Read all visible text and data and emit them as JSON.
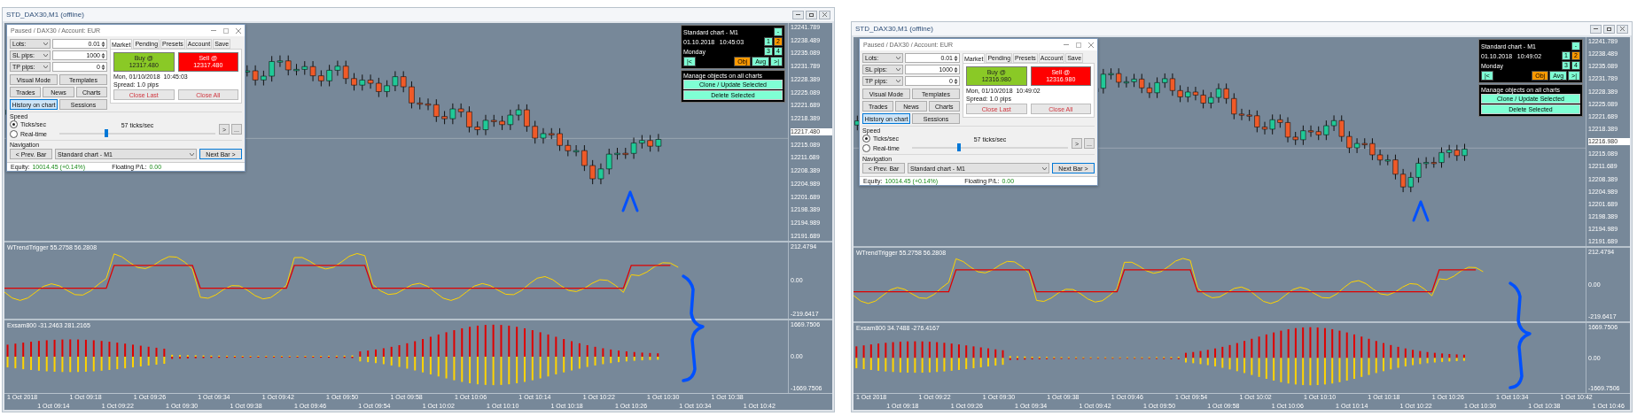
{
  "windows": [
    {
      "title": "STD_DAX30,M1 (offline)",
      "dialog": {
        "title": "Paused / DAX30 / Account: EUR",
        "params": [
          {
            "label": "Lots:",
            "value": "0.01"
          },
          {
            "label": "SL pips:",
            "value": "1000"
          },
          {
            "label": "TP pips:",
            "value": "0"
          }
        ],
        "buttons": [
          {
            "label": "Visual Mode",
            "selected": false
          },
          {
            "label": "Templates",
            "selected": false
          },
          {
            "label": "Trades",
            "selected": false
          },
          {
            "label": "News",
            "selected": false
          },
          {
            "label": "Charts",
            "selected": false
          },
          {
            "label": "History on chart",
            "selected": true
          },
          {
            "label": "Sessions",
            "selected": false
          }
        ],
        "tabs": [
          {
            "label": "Market",
            "selected": true
          },
          {
            "label": "Pending",
            "selected": false
          },
          {
            "label": "Presets",
            "selected": false
          },
          {
            "label": "Account",
            "selected": false
          },
          {
            "label": "Save",
            "selected": false
          }
        ],
        "buy": {
          "label": "Buy @",
          "price": "12317.480"
        },
        "sell": {
          "label": "Sell @",
          "price": "12317.480"
        },
        "time": "Mon, 01/10/2018  10:45:03",
        "spread": "Spread: 1.0 pips",
        "close_buttons": [
          "Close Last",
          "Close All"
        ],
        "speed": {
          "title": "Speed",
          "modes": [
            {
              "label": "Ticks/sec",
              "selected": true
            },
            {
              "label": "Real-time",
              "selected": false
            }
          ],
          "rate": "57 ticks/sec",
          "level": 0.3,
          "buttons": [
            ">",
            "..."
          ]
        },
        "navigation": {
          "title": "Navigation",
          "prev": "< Prev. Bar",
          "chart": "Standard chart - M1",
          "next": "Next Bar >"
        },
        "equity": {
          "label": "Equity:",
          "value": "10014.45 (+0.14%)"
        },
        "floating": {
          "label": "Floating P/L:",
          "value": "0.00"
        }
      },
      "overlay": {
        "chart": "Standard chart - M1",
        "collapse": "-",
        "date": "01.10.2018   10:45:03",
        "day": "Monday",
        "pages": [
          {
            "label": "1",
            "selected": false
          },
          {
            "label": "2",
            "selected": true
          },
          {
            "label": "3",
            "selected": false
          },
          {
            "label": "4",
            "selected": false
          }
        ],
        "nav": [
          {
            "label": "|<",
            "selected": false
          },
          {
            "label": "Obj",
            "selected": true
          },
          {
            "label": "Avg",
            "selected": false
          },
          {
            "label": ">|",
            "selected": false
          }
        ],
        "manage_title": "Manage objects on all charts",
        "actions": [
          "Clone / Update Selected",
          "Delete Selected"
        ]
      },
      "price_axis": [
        {
          "text": "12241.789",
          "kind": "tick"
        },
        {
          "text": "12238.489",
          "kind": "tick"
        },
        {
          "text": "12235.089",
          "kind": "tick"
        },
        {
          "text": "12231.789",
          "kind": "tick"
        },
        {
          "text": "12228.389",
          "kind": "tick"
        },
        {
          "text": "12225.089",
          "kind": "tick"
        },
        {
          "text": "12221.689",
          "kind": "tick"
        },
        {
          "text": "12218.389",
          "kind": "tick"
        },
        {
          "text": "12217.480",
          "kind": "current"
        },
        {
          "text": "12215.089",
          "kind": "tick"
        },
        {
          "text": "12211.689",
          "kind": "tick"
        },
        {
          "text": "12208.389",
          "kind": "tick"
        },
        {
          "text": "12204.989",
          "kind": "tick"
        },
        {
          "text": "12201.689",
          "kind": "tick"
        },
        {
          "text": "12198.389",
          "kind": "tick"
        },
        {
          "text": "12194.989",
          "kind": "tick"
        },
        {
          "text": "12191.689",
          "kind": "tick"
        }
      ],
      "indicator": {
        "title": "WTrendTrigger 55.2758 56.2808",
        "axis": [
          "212.4794",
          "0.00",
          "-219.6417"
        ]
      },
      "histogram": {
        "title": "Exsam800 -31.2463 281.2165",
        "axis": [
          "1669.7506",
          "0.00",
          "-1669.7506"
        ]
      },
      "time_axis": [
        "1 Oct 2018",
        "1 Oct 09:14",
        "1 Oct 09:18",
        "1 Oct 09:22",
        "1 Oct 09:26",
        "1 Oct 09:30",
        "1 Oct 09:34",
        "1 Oct 09:38",
        "1 Oct 09:42",
        "1 Oct 09:46",
        "1 Oct 09:50",
        "1 Oct 09:54",
        "1 Oct 09:58",
        "1 Oct 10:02",
        "1 Oct 10:06",
        "1 Oct 10:10",
        "1 Oct 10:14",
        "1 Oct 10:18",
        "1 Oct 10:22",
        "1 Oct 10:26",
        "1 Oct 10:30",
        "1 Oct 10:34",
        "1 Oct 10:38",
        "1 Oct 10:42"
      ]
    },
    {
      "title": "STD_DAX30,M1 (offline)",
      "dialog": {
        "title": "Paused / DAX30 / Account: EUR",
        "params": [
          {
            "label": "Lots:",
            "value": "0.01"
          },
          {
            "label": "SL pips:",
            "value": "1000"
          },
          {
            "label": "TP pips:",
            "value": "0"
          }
        ],
        "buttons": [
          {
            "label": "Visual Mode",
            "selected": false
          },
          {
            "label": "Templates",
            "selected": false
          },
          {
            "label": "Trades",
            "selected": false
          },
          {
            "label": "News",
            "selected": false
          },
          {
            "label": "Charts",
            "selected": false
          },
          {
            "label": "History on chart",
            "selected": true
          },
          {
            "label": "Sessions",
            "selected": false
          }
        ],
        "tabs": [
          {
            "label": "Market",
            "selected": true
          },
          {
            "label": "Pending",
            "selected": false
          },
          {
            "label": "Presets",
            "selected": false
          },
          {
            "label": "Account",
            "selected": false
          },
          {
            "label": "Save",
            "selected": false
          }
        ],
        "buy": {
          "label": "Buy @",
          "price": "12316.980"
        },
        "sell": {
          "label": "Sell @",
          "price": "12316.980"
        },
        "time": "Mon, 01/10/2018  10:49:02",
        "spread": "Spread: 1.0 pips",
        "close_buttons": [
          "Close Last",
          "Close All"
        ],
        "speed": {
          "title": "Speed",
          "modes": [
            {
              "label": "Ticks/sec",
              "selected": true
            },
            {
              "label": "Real-time",
              "selected": false
            }
          ],
          "rate": "57 ticks/sec",
          "level": 0.3,
          "buttons": [
            ">",
            "..."
          ]
        },
        "navigation": {
          "title": "Navigation",
          "prev": "< Prev. Bar",
          "chart": "Standard chart - M1",
          "next": "Next Bar >"
        },
        "equity": {
          "label": "Equity:",
          "value": "10014.45 (+0.14%)"
        },
        "floating": {
          "label": "Floating P/L:",
          "value": "0.00"
        }
      },
      "overlay": {
        "chart": "Standard chart - M1",
        "collapse": "-",
        "date": "01.10.2018   10:49:02",
        "day": "Monday",
        "pages": [
          {
            "label": "1",
            "selected": false
          },
          {
            "label": "2",
            "selected": true
          },
          {
            "label": "3",
            "selected": false
          },
          {
            "label": "4",
            "selected": false
          }
        ],
        "nav": [
          {
            "label": "|<",
            "selected": false
          },
          {
            "label": "Obj",
            "selected": true
          },
          {
            "label": "Avg",
            "selected": false
          },
          {
            "label": ">|",
            "selected": false
          }
        ],
        "manage_title": "Manage objects on all charts",
        "actions": [
          "Clone / Update Selected",
          "Delete Selected"
        ]
      },
      "price_axis": [
        {
          "text": "12241.789",
          "kind": "tick"
        },
        {
          "text": "12238.489",
          "kind": "tick"
        },
        {
          "text": "12235.089",
          "kind": "tick"
        },
        {
          "text": "12231.789",
          "kind": "tick"
        },
        {
          "text": "12228.389",
          "kind": "tick"
        },
        {
          "text": "12225.089",
          "kind": "tick"
        },
        {
          "text": "12221.689",
          "kind": "tick"
        },
        {
          "text": "12218.389",
          "kind": "tick"
        },
        {
          "text": "12216.980",
          "kind": "current"
        },
        {
          "text": "12215.089",
          "kind": "tick"
        },
        {
          "text": "12211.689",
          "kind": "tick"
        },
        {
          "text": "12208.389",
          "kind": "tick"
        },
        {
          "text": "12204.989",
          "kind": "tick"
        },
        {
          "text": "12201.689",
          "kind": "tick"
        },
        {
          "text": "12198.389",
          "kind": "tick"
        },
        {
          "text": "12194.989",
          "kind": "tick"
        },
        {
          "text": "12191.689",
          "kind": "tick"
        }
      ],
      "indicator": {
        "title": "WTrendTrigger 55.2758 56.2808",
        "axis": [
          "212.4794",
          "0.00",
          "-219.6417"
        ]
      },
      "histogram": {
        "title": "Exsam800 34.7488 -276.4167",
        "axis": [
          "1669.7506",
          "0.00",
          "-1669.7506"
        ]
      },
      "time_axis": [
        "1 Oct 2018",
        "1 Oct 09:18",
        "1 Oct 09:22",
        "1 Oct 09:26",
        "1 Oct 09:30",
        "1 Oct 09:34",
        "1 Oct 09:38",
        "1 Oct 09:42",
        "1 Oct 09:46",
        "1 Oct 09:50",
        "1 Oct 09:54",
        "1 Oct 09:58",
        "1 Oct 10:02",
        "1 Oct 10:06",
        "1 Oct 10:10",
        "1 Oct 10:14",
        "1 Oct 10:18",
        "1 Oct 10:22",
        "1 Oct 10:26",
        "1 Oct 10:30",
        "1 Oct 10:34",
        "1 Oct 10:38",
        "1 Oct 10:42",
        "1 Oct 10:46"
      ]
    }
  ]
}
